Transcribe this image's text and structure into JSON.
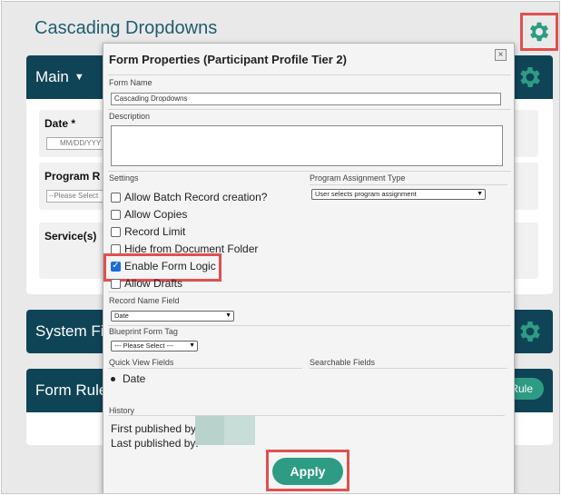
{
  "page": {
    "title": "Cascading Dropdowns"
  },
  "sections": {
    "main": {
      "title": "Main",
      "caret": "▼"
    },
    "system": {
      "title": "System Fi"
    },
    "rules": {
      "title": "Form Rule",
      "button": "Rule"
    }
  },
  "fields": {
    "date_label": "Date *",
    "date_placeholder": "MM/DD/YYY",
    "program_label": "Program R",
    "program_placeholder": "--Please Select",
    "services_label": "Service(s)"
  },
  "modal": {
    "title": "Form Properties (Participant Profile Tier 2)",
    "close": "×",
    "form_name_label": "Form Name",
    "form_name_value": "Cascading Dropdowns",
    "description_label": "Description",
    "settings_label": "Settings",
    "program_assignment_label": "Program Assignment Type",
    "program_assignment_value": "User selects program assignment",
    "checkboxes": [
      {
        "label": "Allow Batch Record creation?",
        "checked": false
      },
      {
        "label": "Allow Copies",
        "checked": false
      },
      {
        "label": "Record Limit",
        "checked": false
      },
      {
        "label": "Hide from Document Folder",
        "checked": false
      },
      {
        "label": "Enable Form Logic",
        "checked": true
      },
      {
        "label": "Allow Drafts",
        "checked": false
      }
    ],
    "record_name_label": "Record Name Field",
    "record_name_value": "Date",
    "blueprint_label": "Blueprint Form Tag",
    "blueprint_value": "--- Please Select ---",
    "quick_view_label": "Quick View Fields",
    "searchable_label": "Searchable Fields",
    "quick_view_items": [
      "Date"
    ],
    "history_label": "History",
    "first_published": "First published by:",
    "last_published": "Last published by:",
    "apply": "Apply"
  },
  "colors": {
    "header_bg": "#0f4457",
    "accent_green": "#2e9c84",
    "highlight_red": "#e05050",
    "title_teal": "#1f5c6e"
  }
}
